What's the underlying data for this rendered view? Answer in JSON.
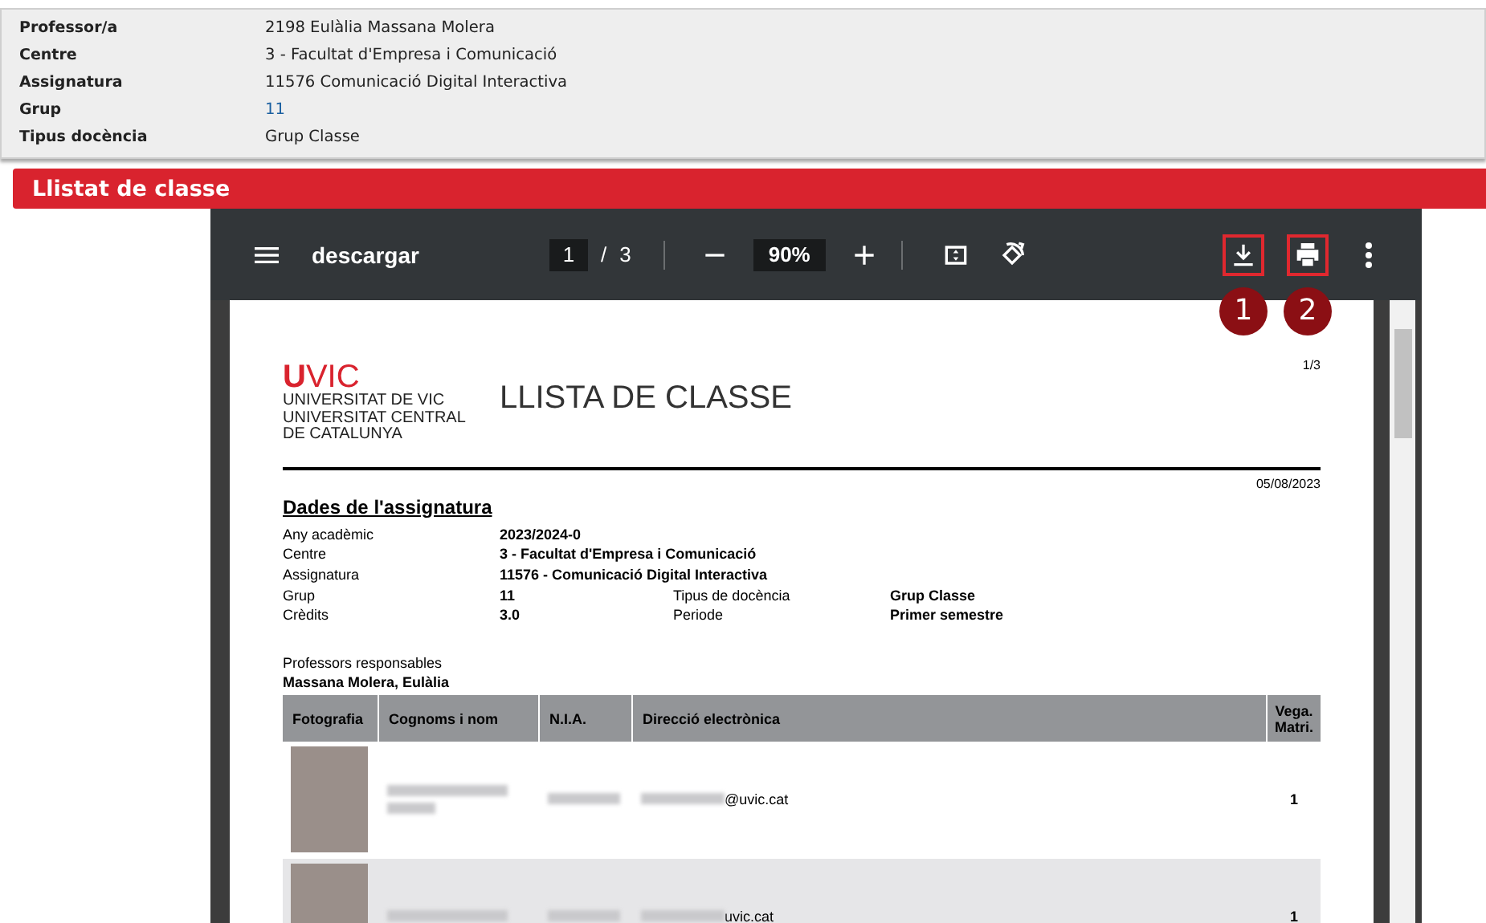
{
  "info_panel": {
    "fields": [
      {
        "label": "Professor/a",
        "value": "2198 Eulàlia Massana Molera",
        "kind": "plain"
      },
      {
        "label": "Centre",
        "value": "3 -  Facultat d'Empresa i Comunicació",
        "kind": "plain"
      },
      {
        "label": "Assignatura",
        "value": "11576  Comunicació Digital Interactiva",
        "kind": "plain"
      },
      {
        "label": "Grup",
        "value": "11",
        "kind": "link"
      },
      {
        "label": "Tipus docència",
        "value": "Grup Classe",
        "kind": "plain"
      }
    ]
  },
  "section_header": {
    "title": "Llistat de classe"
  },
  "pdf_viewer": {
    "toolbar": {
      "title": "descargar",
      "page": "1",
      "page_separator": "/",
      "page_count": "3",
      "zoom": "90%"
    },
    "actions": [
      {
        "kind": "download",
        "highlighted": true,
        "callout": "1"
      },
      {
        "kind": "print",
        "highlighted": true,
        "callout": "2"
      },
      {
        "kind": "more",
        "highlighted": false
      }
    ],
    "document": {
      "logo": {
        "mark": "U",
        "name": "VIC",
        "lines": [
          "UNIVERSITAT DE VIC",
          "UNIVERSITAT CENTRAL",
          "DE CATALUNYA"
        ]
      },
      "page_number": "1/3",
      "title": "LLISTA DE CLASSE",
      "date": "05/08/2023",
      "section_title": "Dades de l'assignatura",
      "details": [
        [
          {
            "label": "Any acadèmic",
            "value": "2023/2024-0"
          }
        ],
        [
          {
            "label": "Centre",
            "value": "3 - Facultat d'Empresa i Comunicació"
          }
        ],
        [
          {
            "label": "Assignatura",
            "value": "11576 - Comunicació Digital Interactiva"
          }
        ],
        [
          {
            "label": "Grup",
            "value": "11"
          },
          {
            "label": "Tipus de docència",
            "value": "Grup Classe"
          }
        ],
        [
          {
            "label": "Crèdits",
            "value": "3.0"
          },
          {
            "label": "Periode",
            "value": "Primer semestre"
          }
        ]
      ],
      "responsible_label": "Professors responsables",
      "responsible_name": "Massana Molera, Eulàlia",
      "table": {
        "columns": [
          "Fotografia",
          "Cognoms i nom",
          "N.I.A.",
          "Direcció electrònica",
          "Vega. Matri."
        ],
        "rows": [
          {
            "email": "@uvic.cat",
            "count": "1"
          },
          {
            "email": "uvic.cat",
            "count": "1"
          }
        ]
      }
    }
  }
}
